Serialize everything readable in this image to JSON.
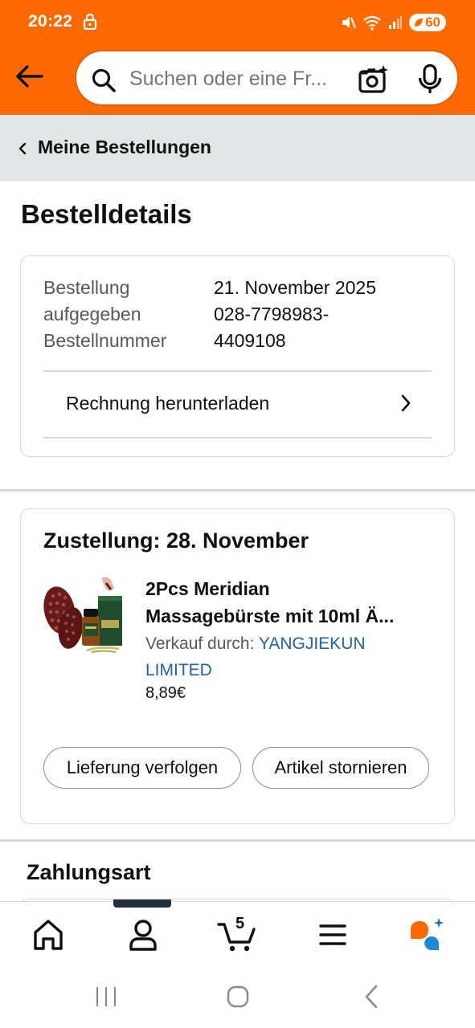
{
  "status_bar": {
    "time": "20:22",
    "battery": "60"
  },
  "search": {
    "placeholder": "Suchen oder eine Fr..."
  },
  "breadcrumb": {
    "label": "Meine Bestellungen"
  },
  "page": {
    "title": "Bestelldetails"
  },
  "order": {
    "placed_label_line1": "Bestellung",
    "placed_label_line2": "aufgegeben",
    "placed_value": "21. November 2025",
    "number_label": "Bestellnummer",
    "number_value_line1": "028-7798983-",
    "number_value_line2": "4409108",
    "invoice_label": "Rechnung herunterladen"
  },
  "delivery": {
    "title": "Zustellung: 28. November",
    "product_title_line1": "2Pcs Meridian",
    "product_title_line2": "Massagebürste mit 10ml Ä...",
    "seller_prefix": "Verkauf durch:",
    "seller_name_line1": "YANGJIEKUN",
    "seller_name_line2": "LIMITED",
    "price": "8,89€",
    "track_button": "Lieferung verfolgen",
    "cancel_button": "Artikel stornieren"
  },
  "payment": {
    "title": "Zahlungsart"
  },
  "bottom_nav": {
    "cart_count": "5",
    "items": [
      "home-icon",
      "account-icon",
      "cart-icon",
      "menu-icon",
      "rufus-icon"
    ]
  },
  "colors": {
    "brand_orange": "#ff6a00",
    "link_blue": "#2162a1",
    "crumb_bg": "#e3e6e6",
    "text": "#0f1111",
    "muted": "#565959"
  }
}
